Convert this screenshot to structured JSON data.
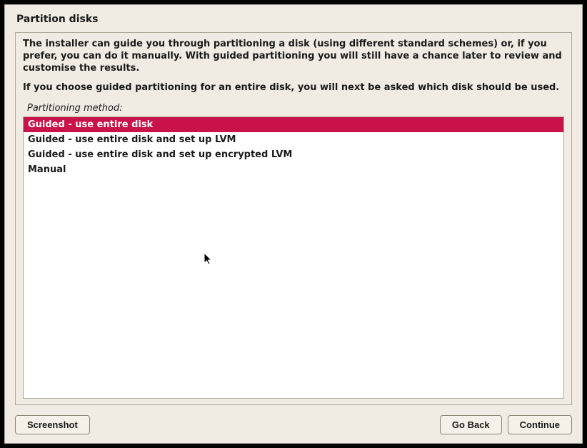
{
  "title": "Partition disks",
  "description_p1": "The installer can guide you through partitioning a disk (using different standard schemes) or, if you prefer, you can do it manually. With guided partitioning you will still have a chance later to review and customise the results.",
  "description_p2": "If you choose guided partitioning for an entire disk, you will next be asked which disk should be used.",
  "sublabel": "Partitioning method:",
  "options": [
    {
      "label": "Guided - use entire disk",
      "selected": true
    },
    {
      "label": "Guided - use entire disk and set up LVM",
      "selected": false
    },
    {
      "label": "Guided - use entire disk and set up encrypted LVM",
      "selected": false
    },
    {
      "label": "Manual",
      "selected": false
    }
  ],
  "buttons": {
    "screenshot": "Screenshot",
    "go_back": "Go Back",
    "continue": "Continue"
  }
}
